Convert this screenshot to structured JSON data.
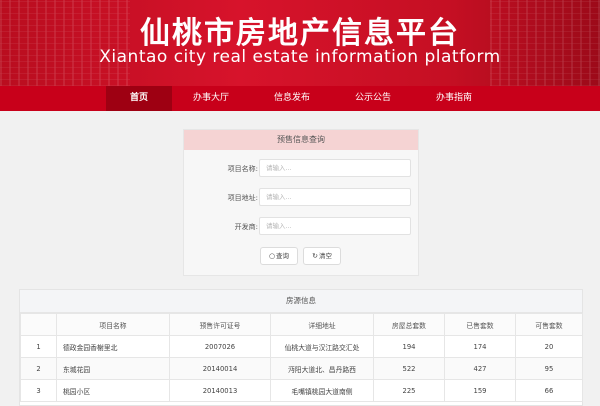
{
  "header": {
    "title_cn": "仙桃市房地产信息平台",
    "title_en": "Xiantao city real estate information platform"
  },
  "nav": {
    "items": [
      {
        "label": "首页"
      },
      {
        "label": "办事大厅"
      },
      {
        "label": "信息发布"
      },
      {
        "label": "公示公告"
      },
      {
        "label": "办事指南"
      }
    ],
    "active_index": 0
  },
  "query_panel": {
    "title": "预售信息查询",
    "fields": [
      {
        "label": "项目名称:",
        "placeholder": "请输入..."
      },
      {
        "label": "项目地址:",
        "placeholder": "请输入..."
      },
      {
        "label": "开发商:",
        "placeholder": "请输入..."
      }
    ],
    "search_label": "查询",
    "clear_label": "清空"
  },
  "results": {
    "title": "房源信息",
    "columns": [
      "",
      "项目名称",
      "预售许可证号",
      "详细地址",
      "房屋总套数",
      "已售套数",
      "可售套数"
    ],
    "rows": [
      {
        "index": "1",
        "name": "德政金园香榭里北",
        "permit": "2007026",
        "address": "仙桃大道与汉江路交汇处",
        "total": "194",
        "sold": "174",
        "available": "20"
      },
      {
        "index": "2",
        "name": "东城花园",
        "permit": "20140014",
        "address": "沔阳大道北、昌丹路西",
        "total": "522",
        "sold": "427",
        "available": "95"
      },
      {
        "index": "3",
        "name": "桃园小区",
        "permit": "20140013",
        "address": "毛嘴镇桃园大道南侧",
        "total": "225",
        "sold": "159",
        "available": "66"
      }
    ]
  },
  "colors": {
    "banner": "#d7132b",
    "nav": "#c8001a",
    "nav_active": "#9e0012",
    "panel_header": "#f5d3d3"
  }
}
